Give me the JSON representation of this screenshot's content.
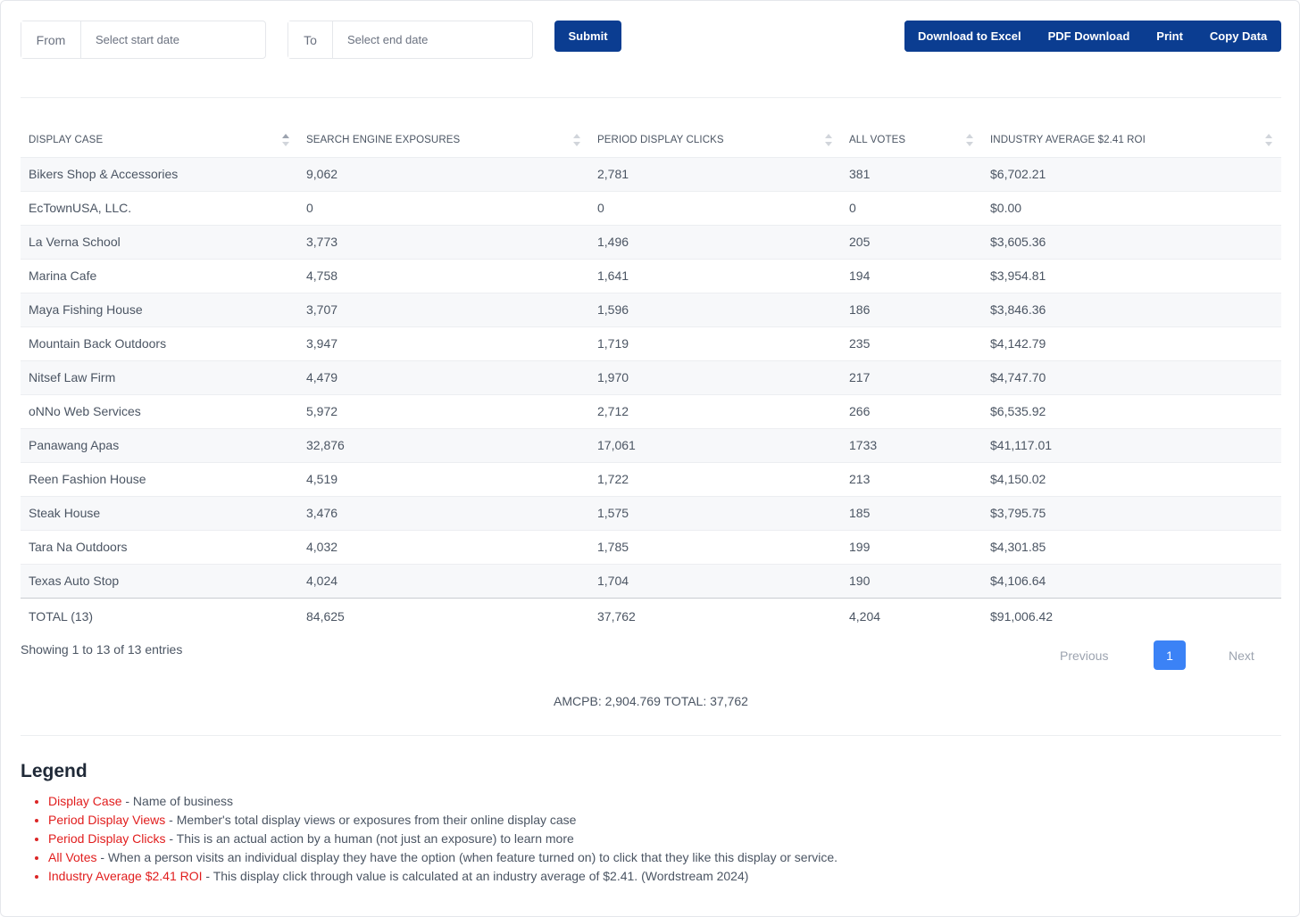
{
  "filters": {
    "from_label": "From",
    "from_placeholder": "Select start date",
    "to_label": "To",
    "to_placeholder": "Select end date",
    "submit_label": "Submit"
  },
  "export_buttons": {
    "excel": "Download to Excel",
    "pdf": "PDF Download",
    "print": "Print",
    "copy": "Copy Data"
  },
  "table": {
    "headers": [
      "DISPLAY CASE",
      "SEARCH ENGINE EXPOSURES",
      "PERIOD DISPLAY CLICKS",
      "ALL VOTES",
      "INDUSTRY AVERAGE $2.41 ROI"
    ],
    "rows": [
      [
        "Bikers Shop & Accessories",
        "9,062",
        "2,781",
        "381",
        "$6,702.21"
      ],
      [
        "EcTownUSA, LLC.",
        "0",
        "0",
        "0",
        "$0.00"
      ],
      [
        "La Verna School",
        "3,773",
        "1,496",
        "205",
        "$3,605.36"
      ],
      [
        "Marina Cafe",
        "4,758",
        "1,641",
        "194",
        "$3,954.81"
      ],
      [
        "Maya Fishing House",
        "3,707",
        "1,596",
        "186",
        "$3,846.36"
      ],
      [
        "Mountain Back Outdoors",
        "3,947",
        "1,719",
        "235",
        "$4,142.79"
      ],
      [
        "Nitsef Law Firm",
        "4,479",
        "1,970",
        "217",
        "$4,747.70"
      ],
      [
        "oNNo Web Services",
        "5,972",
        "2,712",
        "266",
        "$6,535.92"
      ],
      [
        "Panawang Apas",
        "32,876",
        "17,061",
        "1733",
        "$41,117.01"
      ],
      [
        "Reen Fashion House",
        "4,519",
        "1,722",
        "213",
        "$4,150.02"
      ],
      [
        "Steak House",
        "3,476",
        "1,575",
        "185",
        "$3,795.75"
      ],
      [
        "Tara Na Outdoors",
        "4,032",
        "1,785",
        "199",
        "$4,301.85"
      ],
      [
        "Texas Auto Stop",
        "4,024",
        "1,704",
        "190",
        "$4,106.64"
      ]
    ],
    "footer": [
      "TOTAL (13)",
      "84,625",
      "37,762",
      "4,204",
      "$91,006.42"
    ]
  },
  "pagination": {
    "info": "Showing 1 to 13 of 13 entries",
    "previous": "Previous",
    "current_page": "1",
    "next": "Next"
  },
  "summary": "AMCPB: 2,904.769 TOTAL: 37,762",
  "legend": {
    "title": "Legend",
    "items": [
      {
        "term": "Display Case",
        "desc": " - Name of business"
      },
      {
        "term": "Period Display Views",
        "desc": " - Member's total display views or exposures from their online display case"
      },
      {
        "term": "Period Display Clicks",
        "desc": " - This is an actual action by a human (not just an exposure) to learn more"
      },
      {
        "term": "All Votes",
        "desc": " - When a person visits an individual display they have the option (when feature turned on) to click that they like this display or service."
      },
      {
        "term": "Industry Average $2.41 ROI",
        "desc": " - This display click through value is calculated at an industry average of $2.41. (Wordstream 2024)"
      }
    ]
  },
  "colors": {
    "primary_button": "#0b3d91",
    "active_page": "#3b82f6",
    "legend_term": "#e11d1d"
  }
}
